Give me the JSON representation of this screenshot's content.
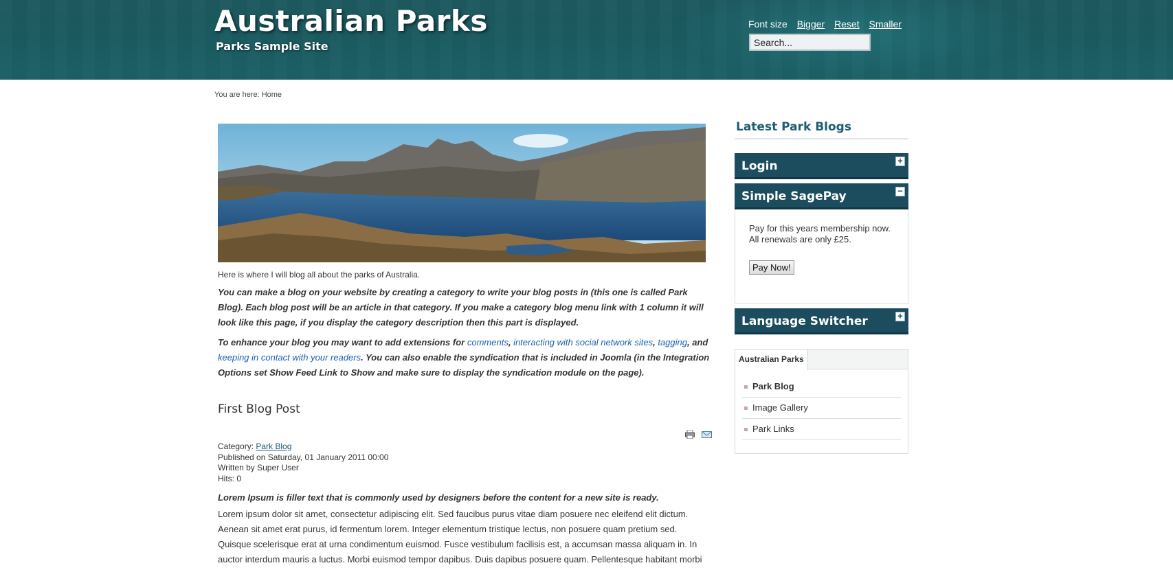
{
  "header": {
    "site_title": "Australian Parks",
    "site_subtitle": "Parks Sample Site",
    "font_size_label": "Font size",
    "bigger": "Bigger",
    "reset": "Reset",
    "smaller": "Smaller",
    "search_value": "Search..."
  },
  "breadcrumb": "You are here: Home",
  "main": {
    "intro": "Here is where I will blog all about the parks of Australia.",
    "para1": "You can make a blog on your website by creating a category to write your blog posts in (this one is called Park Blog). Each blog post will be an article in that category. If you make a category blog menu link with 1 column it will look like this page, if you display the category description then this part is displayed.",
    "para2_a": "To enhance your blog you may want to add extensions for ",
    "link_comments": "comments",
    "sep1": ", ",
    "link_social": "interacting with social network sites",
    "sep2": ", ",
    "link_tagging": "tagging",
    "sep3": ", and ",
    "link_readers": "keeping in contact with your readers",
    "para2_b": ". You can also enable the syndication that is included in Joomla (in the Integration Options set Show Feed Link to Show and make sure to display the syndication module on the page).",
    "post_title": "First Blog Post",
    "category_label": "Category: ",
    "category_link": "Park Blog",
    "published": "Published on Saturday, 01 January 2011 00:00",
    "written_by": "Written by Super User",
    "hits": "Hits: 0",
    "lead": "Lorem Ipsum is filler text that is commonly used by designers before the content for a new site is ready.",
    "body": "Lorem ipsum dolor sit amet, consectetur adipiscing elit. Sed faucibus purus vitae diam posuere nec eleifend elit dictum. Aenean sit amet erat purus, id fermentum lorem. Integer elementum tristique lectus, non posuere quam pretium sed. Quisque scelerisque erat at urna condimentum euismod. Fusce vestibulum facilisis est, a accumsan massa aliquam in. In auctor interdum mauris a luctus. Morbi euismod tempor dapibus. Duis dapibus posuere quam. Pellentesque habitant morbi"
  },
  "sidebar": {
    "latest_title": "Latest Park Blogs",
    "login": "Login",
    "login_toggle": "+",
    "sagepay": "Simple SagePay",
    "sagepay_toggle": "−",
    "sagepay_text1": "Pay for this years membership now.",
    "sagepay_text2": "All renewals are only £25.",
    "pay_button": "Pay Now!",
    "language": "Language Switcher",
    "language_toggle": "+",
    "tab_label": "Australian Parks",
    "tab_items": [
      "Park Blog",
      "Image Gallery",
      "Park Links"
    ]
  },
  "colors": {
    "header_bg": "#1a5a60",
    "module_header": "#1b4d5e",
    "link": "#1b5fae"
  }
}
